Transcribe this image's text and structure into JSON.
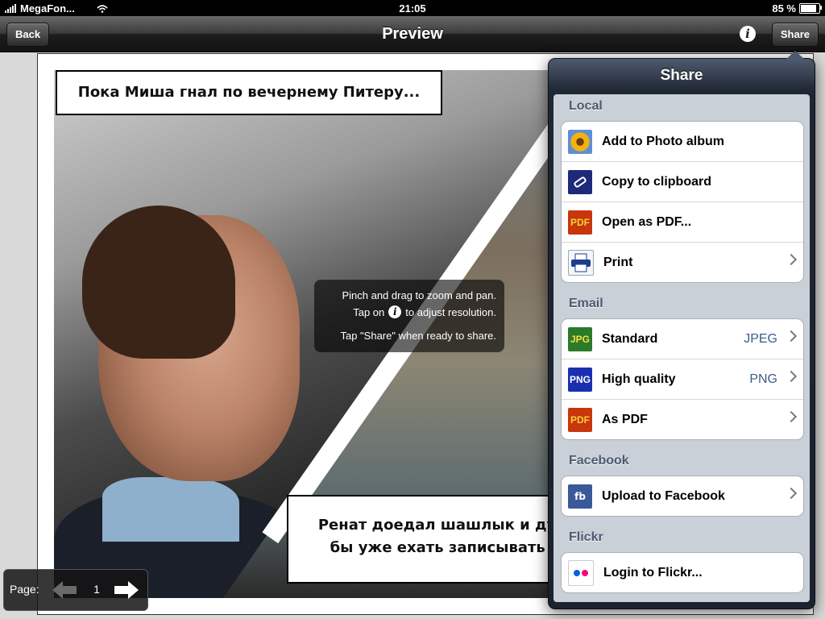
{
  "status_bar": {
    "carrier": "MegaFon...",
    "time": "21:05",
    "battery": "85 %",
    "battery_level": 0.85
  },
  "nav": {
    "title": "Preview",
    "back_label": "Back",
    "share_label": "Share",
    "info_glyph": "i"
  },
  "comic": {
    "caption_top": "Пока Миша гнал по вечернему Питеру...",
    "caption_bottom_line1": "Ренат доедал шашлык и думал,",
    "caption_bottom_line2": "бы уже ехать записывать под"
  },
  "hint": {
    "line1": "Pinch and drag to zoom and pan.",
    "line2_before": "Tap on",
    "line2_after": "to adjust resolution.",
    "line3": "Tap \"Share\" when ready to share.",
    "info_glyph": "i"
  },
  "page_control": {
    "label": "Page:",
    "current": "1"
  },
  "share": {
    "title": "Share",
    "sections": [
      {
        "header": "Local",
        "items": [
          {
            "label": "Add to Photo album",
            "icon": "photo-album-icon"
          },
          {
            "label": "Copy to clipboard",
            "icon": "clipboard-icon"
          },
          {
            "label": "Open as PDF...",
            "icon": "pdf-icon",
            "badge": "PDF"
          },
          {
            "label": "Print",
            "icon": "printer-icon"
          }
        ]
      },
      {
        "header": "Email",
        "items": [
          {
            "label": "Standard",
            "detail": "JPEG",
            "icon": "jpg-icon",
            "badge": "JPG"
          },
          {
            "label": "High quality",
            "detail": "PNG",
            "icon": "png-icon",
            "badge": "PNG"
          },
          {
            "label": "As PDF",
            "icon": "pdf-icon",
            "badge": "PDF"
          }
        ]
      },
      {
        "header": "Facebook",
        "items": [
          {
            "label": "Upload to Facebook",
            "icon": "facebook-icon",
            "badge": "fb"
          }
        ]
      },
      {
        "header": "Flickr",
        "items": [
          {
            "label": "Login to Flickr...",
            "icon": "flickr-icon"
          }
        ]
      }
    ]
  },
  "colors": {
    "section_header": "#4b5b70",
    "detail_text": "#3b5b8c",
    "popover_bg": "#1b2230",
    "flickr_blue": "#0063dc",
    "flickr_pink": "#ff0084"
  }
}
